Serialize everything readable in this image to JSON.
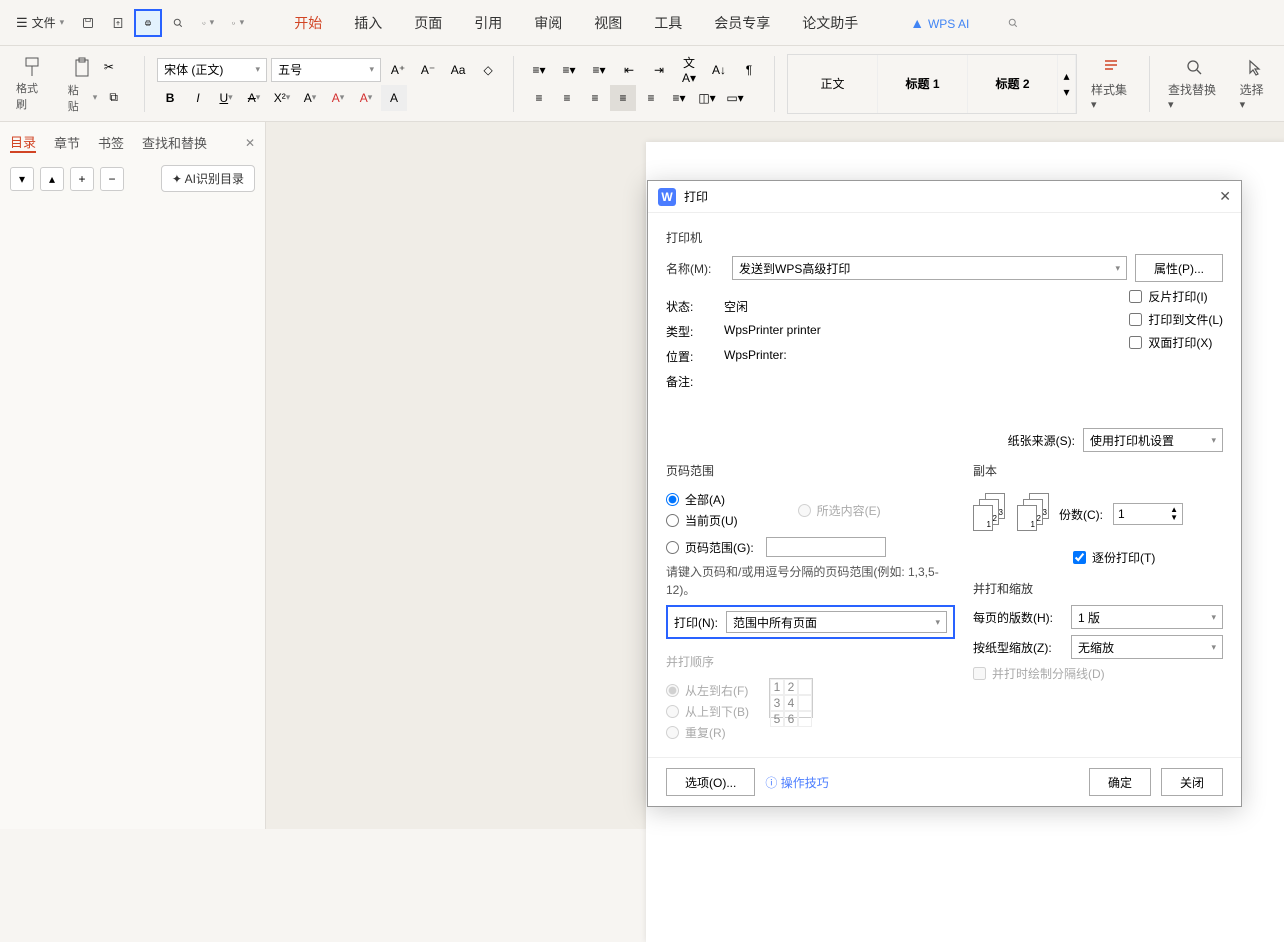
{
  "topbar": {
    "file": "文件",
    "menus": [
      "开始",
      "插入",
      "页面",
      "引用",
      "审阅",
      "视图",
      "工具",
      "会员专享",
      "论文助手"
    ],
    "wps_ai": "WPS AI"
  },
  "ribbon": {
    "format_painter": "格式刷",
    "paste": "粘贴",
    "font": "宋体 (正文)",
    "size": "五号",
    "styles": [
      "正文",
      "标题 1",
      "标题 2"
    ],
    "style_set": "样式集",
    "find_replace": "查找替换",
    "select": "选择"
  },
  "sidebar": {
    "tabs": [
      "目录",
      "章节",
      "书签",
      "查找和替换"
    ],
    "ai_btn": "AI识别目录"
  },
  "dialog": {
    "title": "打印",
    "printer_section": "打印机",
    "name_label": "名称(M):",
    "name_value": "发送到WPS高级打印",
    "properties": "属性(P)...",
    "status_label": "状态:",
    "status_value": "空闲",
    "type_label": "类型:",
    "type_value": "WpsPrinter printer",
    "where_label": "位置:",
    "where_value": "WpsPrinter:",
    "comment_label": "备注:",
    "reverse": "反片打印(I)",
    "tofile": "打印到文件(L)",
    "duplex": "双面打印(X)",
    "paper_source_label": "纸张来源(S):",
    "paper_source_value": "使用打印机设置",
    "range_section": "页码范围",
    "all": "全部(A)",
    "current": "当前页(U)",
    "selection": "所选内容(E)",
    "pages": "页码范围(G):",
    "range_hint": "请键入页码和/或用逗号分隔的页码范围(例如: 1,3,5-12)。",
    "print_n_label": "打印(N):",
    "print_n_value": "范围中所有页面",
    "order_section": "并打顺序",
    "ltr": "从左到右(F)",
    "ttb": "从上到下(B)",
    "repeat": "重复(R)",
    "copies_section": "副本",
    "copies_label": "份数(C):",
    "copies_value": "1",
    "collate": "逐份打印(T)",
    "scale_section": "并打和缩放",
    "per_sheet_label": "每页的版数(H):",
    "per_sheet_value": "1 版",
    "scale_label": "按纸型缩放(Z):",
    "scale_value": "无缩放",
    "draw_lines": "并打时绘制分隔线(D)",
    "options": "选项(O)...",
    "tips": "操作技巧",
    "ok": "确定",
    "cancel": "关闭"
  }
}
